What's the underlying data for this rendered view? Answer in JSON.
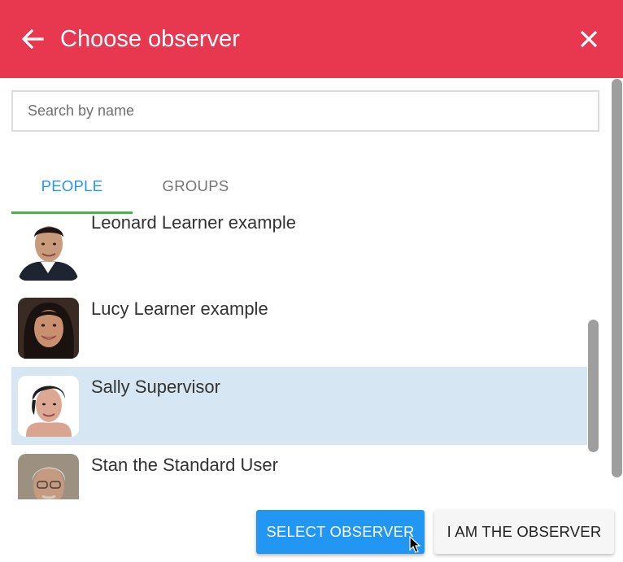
{
  "header": {
    "title": "Choose observer",
    "back_icon": "arrow-left-icon",
    "close_icon": "close-icon",
    "background_color": "#e8384f"
  },
  "search": {
    "placeholder": "Search by name",
    "value": ""
  },
  "tabs": [
    {
      "label": "PEOPLE",
      "active": true
    },
    {
      "label": "GROUPS",
      "active": false
    }
  ],
  "people": [
    {
      "name": "Leonard Learner example",
      "selected": false
    },
    {
      "name": "Lucy Learner example",
      "selected": false
    },
    {
      "name": "Sally Supervisor",
      "selected": true
    },
    {
      "name": "Stan the Standard User",
      "selected": false
    }
  ],
  "actions": {
    "select_label": "SELECT OBSERVER",
    "i_am_label": "I AM THE OBSERVER"
  },
  "colors": {
    "accent": "#2196f3",
    "tab_indicator": "#4caf50",
    "selected_row": "#d6e6f2"
  }
}
